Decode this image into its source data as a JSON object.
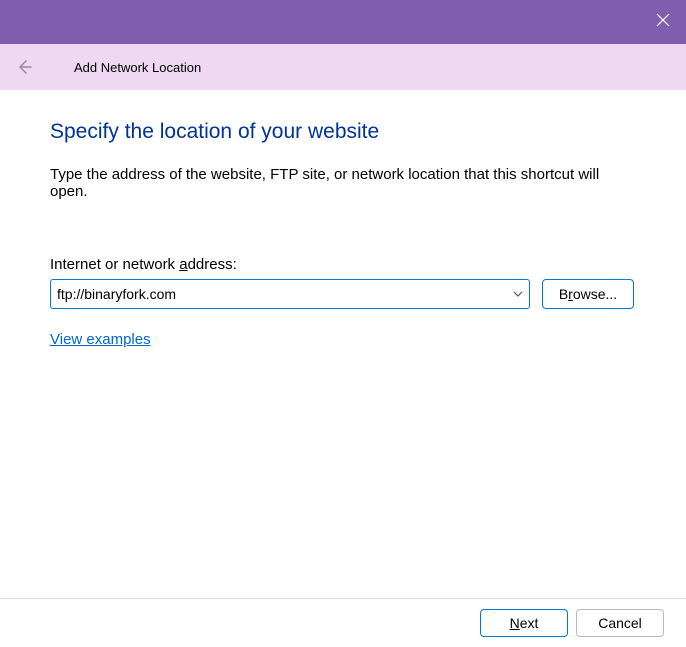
{
  "window": {
    "header_title": "Add Network Location"
  },
  "page": {
    "title": "Specify the location of your website",
    "description": "Type the address of the website, FTP site, or network location that this shortcut will open."
  },
  "field": {
    "label_prefix": "Internet or network ",
    "label_u": "a",
    "label_suffix": "ddress:",
    "value": "ftp://binaryfork.com"
  },
  "browse": {
    "prefix": "B",
    "u": "r",
    "suffix": "owse..."
  },
  "link": {
    "examples": "View examples"
  },
  "footer": {
    "next_u": "N",
    "next_suffix": "ext",
    "cancel": "Cancel"
  }
}
